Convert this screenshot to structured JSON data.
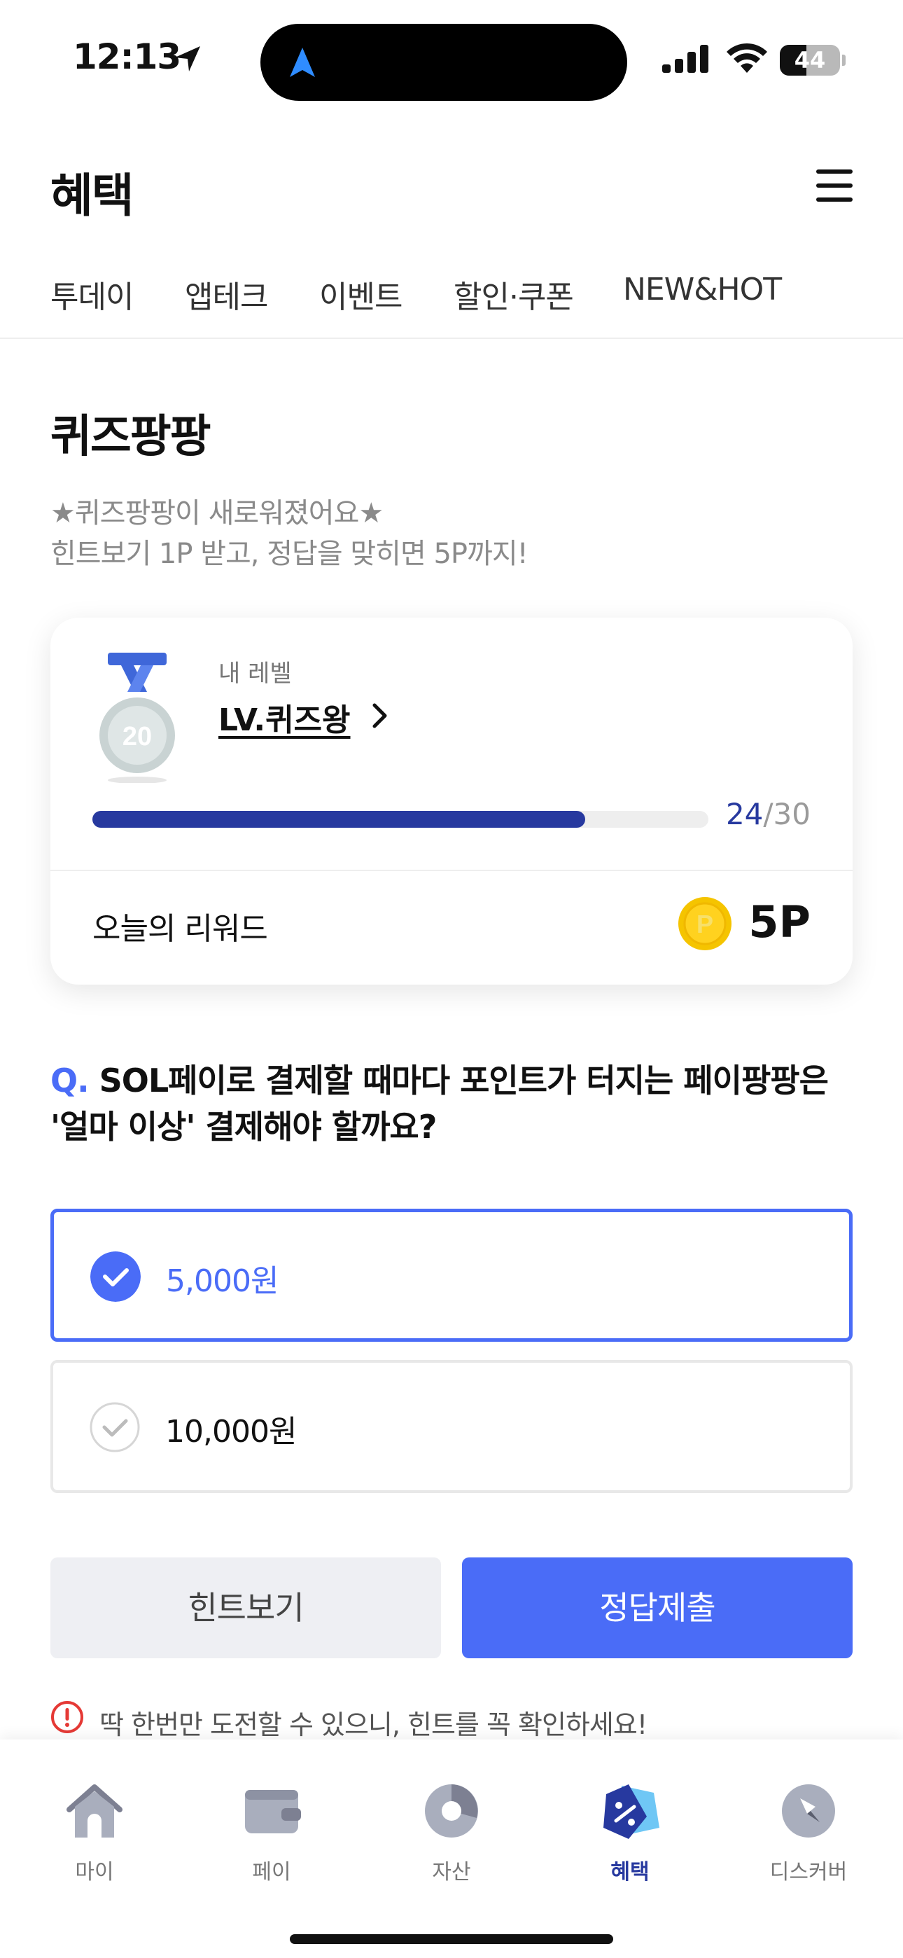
{
  "status_bar": {
    "time": "12:13",
    "battery": "44",
    "battery_level": 0.44
  },
  "header": {
    "title": "혜택",
    "menu_icon": "hamburger-menu-icon"
  },
  "tabs": [
    {
      "label": "투데이",
      "active": true
    },
    {
      "label": "앱테크",
      "active": false
    },
    {
      "label": "이벤트",
      "active": false
    },
    {
      "label": "할인·쿠폰",
      "active": false
    },
    {
      "label": "NEW&HOT",
      "active": false
    }
  ],
  "quiz": {
    "title": "퀴즈팡팡",
    "desc_line1": "★퀴즈팡팡이 새로워졌어요★",
    "desc_line2": "힌트보기 1P 받고, 정답을 맞히면 5P까지!"
  },
  "level_card": {
    "caption": "내 레벨",
    "level_name": "LV.퀴즈왕",
    "medal_number": "20",
    "progress_current": "24",
    "progress_total": "/30",
    "progress_fraction": 0.8,
    "reward_label": "오늘의 리워드",
    "reward_value": "5P"
  },
  "question": {
    "prefix": "Q.",
    "text": "SOL페이로 결제할 때마다 포인트가 터지는 페이팡팡은 '얼마 이상' 결제해야 할까요?"
  },
  "options": [
    {
      "label": "5,000원",
      "selected": true
    },
    {
      "label": "10,000원",
      "selected": false
    }
  ],
  "buttons": {
    "hint": "힌트보기",
    "submit": "정답제출"
  },
  "notice": "딱 한번만 도전할 수 있으니, 힌트를 꼭 확인하세요!",
  "bottom_nav": [
    {
      "label": "마이",
      "icon": "home-icon",
      "active": false
    },
    {
      "label": "페이",
      "icon": "wallet-icon",
      "active": false
    },
    {
      "label": "자산",
      "icon": "pie-chart-icon",
      "active": false
    },
    {
      "label": "혜택",
      "icon": "discount-tag-icon",
      "active": true
    },
    {
      "label": "디스커버",
      "icon": "compass-icon",
      "active": false
    }
  ],
  "colors": {
    "accent": "#4a6cf7",
    "navy": "#27399f",
    "coin": "#f5c400"
  }
}
